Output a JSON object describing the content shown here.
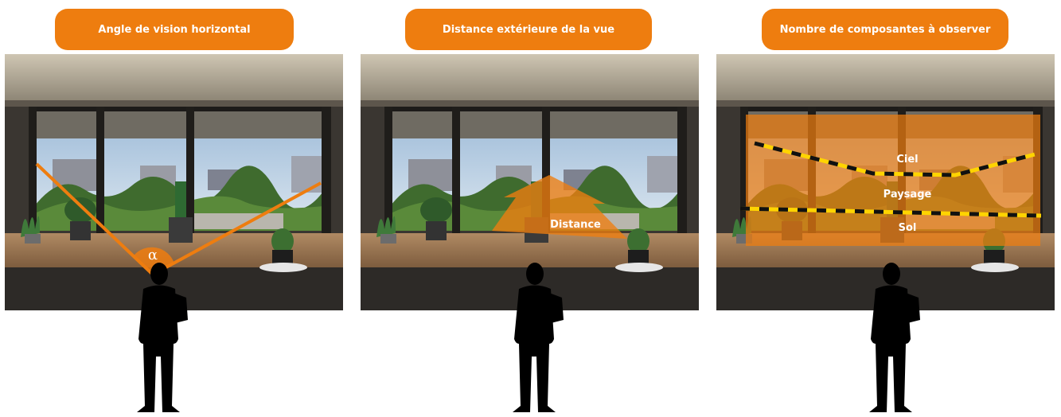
{
  "panels": [
    {
      "title": "Angle de vision horizontal",
      "symbol": "α"
    },
    {
      "title": "Distance extérieure de la vue",
      "arrow_label": "Distance"
    },
    {
      "title": "Nombre de composantes à observer",
      "labels": {
        "sky": "Ciel",
        "landscape": "Paysage",
        "ground": "Sol"
      }
    }
  ],
  "colors": {
    "accent": "#ee7d0f",
    "dash_yellow": "#ffd400",
    "dash_black": "#111111"
  },
  "icons": [
    "window-scene",
    "person-silhouette-icon"
  ]
}
